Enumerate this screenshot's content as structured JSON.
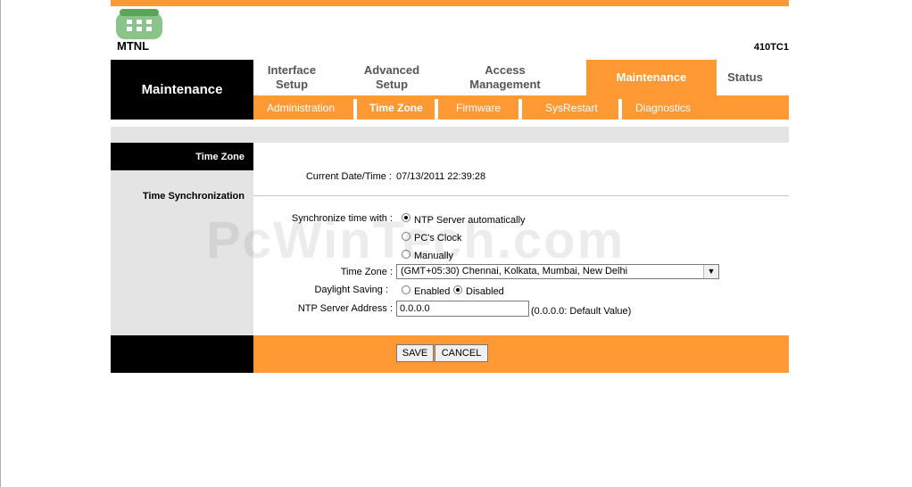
{
  "brand": {
    "logo_text": "MTNL",
    "model": "410TC1",
    "accent": "#ff9933"
  },
  "side_title": "Maintenance",
  "menu": [
    {
      "label": "Interface Setup"
    },
    {
      "label": "Advanced Setup"
    },
    {
      "label": "Access Management"
    },
    {
      "label": "Maintenance",
      "active": true
    },
    {
      "label": "Status"
    }
  ],
  "submenu": [
    {
      "label": "Administration"
    },
    {
      "label": "Time Zone",
      "active": true
    },
    {
      "label": "Firmware"
    },
    {
      "label": "SysRestart"
    },
    {
      "label": "Diagnostics"
    }
  ],
  "sections": {
    "time_zone": "Time Zone",
    "time_sync": "Time Synchronization"
  },
  "form": {
    "current_label": "Current Date/Time :",
    "current_value": "07/13/2011 22:39:28",
    "sync_label": "Synchronize time with :",
    "sync_options": [
      "NTP Server automatically",
      "PC's Clock",
      "Manually"
    ],
    "sync_selected": "NTP Server automatically",
    "tz_label": "Time Zone :",
    "tz_value": "(GMT+05:30) Chennai, Kolkata, Mumbai, New Delhi",
    "dst_label": "Daylight Saving :",
    "dst_options": [
      "Enabled",
      "Disabled"
    ],
    "dst_selected": "Disabled",
    "ntp_label": "NTP Server Address :",
    "ntp_value": "0.0.0.0",
    "ntp_hint": "(0.0.0.0: Default Value)"
  },
  "buttons": {
    "save": "SAVE",
    "cancel": "CANCEL"
  },
  "watermark": "PcWinTech.com"
}
